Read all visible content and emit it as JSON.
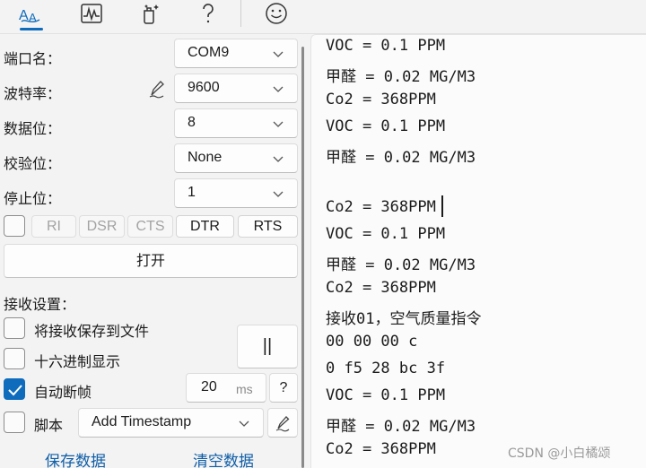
{
  "toolbar": {
    "icons": [
      "text-style-icon",
      "waveform-icon",
      "sparkle-clean-icon",
      "help-icon",
      "smiley-icon"
    ]
  },
  "serial": {
    "port_label": "端口名：",
    "port_value": "COM9",
    "baud_label": "波特率：",
    "baud_value": "9600",
    "databits_label": "数据位：",
    "databits_value": "8",
    "parity_label": "校验位：",
    "parity_value": "None",
    "stopbits_label": "停止位：",
    "stopbits_value": "1"
  },
  "signals": {
    "ri": "RI",
    "dsr": "DSR",
    "cts": "CTS",
    "dtr": "DTR",
    "rts": "RTS"
  },
  "open_button": "打开",
  "receive": {
    "title": "接收设置：",
    "save_to_file": "将接收保存到文件",
    "hex_display": "十六进制显示",
    "auto_frame": "自动断帧",
    "auto_frame_checked": true,
    "frame_value": "20",
    "frame_unit": "ms",
    "help_label": "?",
    "pause_label": "||",
    "script_label": "脚本",
    "timestamp_value": "Add Timestamp"
  },
  "actions": {
    "save_data": "保存数据",
    "clear_data": "清空数据"
  },
  "log": {
    "lines": [
      "VOC = 0.1 PPM",
      "甲醛 = 0.02 MG/M3",
      "Co2 = 368PPM",
      "VOC = 0.1 PPM",
      "甲醛 = 0.02 MG/M3",
      "",
      "Co2 = 368PPM",
      "VOC = 0.1 PPM",
      "甲醛 = 0.02 MG/M3",
      "Co2 = 368PPM",
      "接收01，空气质量指令",
      "00 00 00 c",
      "0 f5 28 bc 3f",
      "VOC = 0.1 PPM",
      "甲醛 = 0.02 MG/M3",
      "Co2 = 368PPM"
    ]
  },
  "watermark": "CSDN @小白橘颂",
  "colors": {
    "accent": "#0f6cbd",
    "link": "#0f5ea8"
  }
}
